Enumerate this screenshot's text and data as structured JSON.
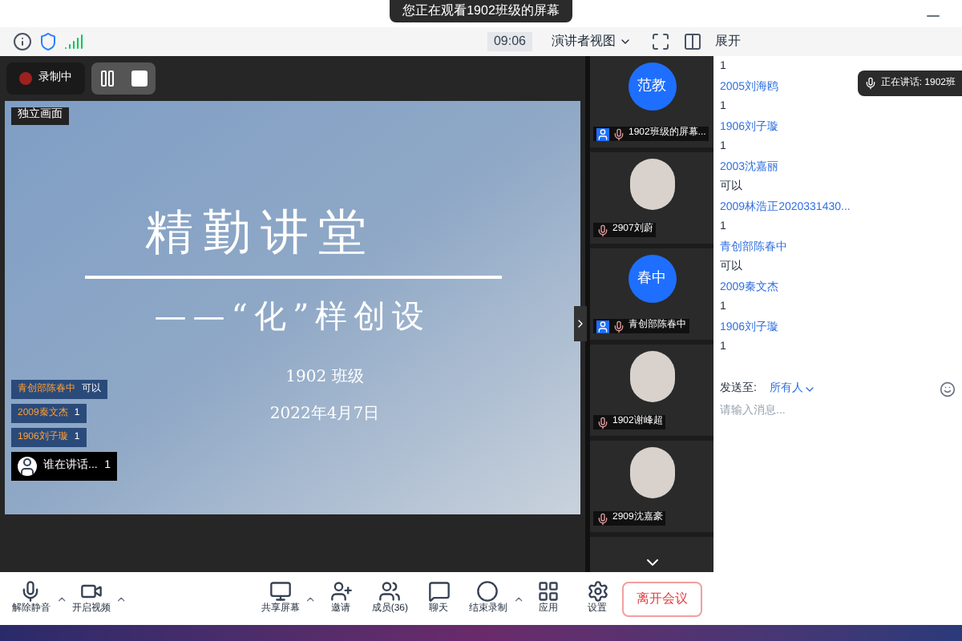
{
  "toast": "您正在观看1902班级的屏幕",
  "top_bar": {
    "time": "09:06",
    "view": "演讲者视图",
    "panel": "展开"
  },
  "recording": {
    "label": "录制中",
    "paused": false
  },
  "screen_label": "独立画面",
  "slide": {
    "title": "精勤讲堂",
    "subtitle": "——“化”样创设",
    "author": "1902 班级",
    "date": "2022年4月7日"
  },
  "danmaku": [
    {
      "name": "青创部陈春中",
      "text": "可以"
    },
    {
      "name": "2009秦文杰",
      "text": "1"
    },
    {
      "name": "1906刘子璇",
      "text": "1"
    }
  ],
  "speaking_bubble": {
    "text": "谁在讲话...",
    "count": "1"
  },
  "tiles": [
    {
      "name": "1902班级的屏幕...",
      "kind": "initials",
      "initials": "范教",
      "color": "#1e6fff",
      "host": true
    },
    {
      "name": "2907刘蔚",
      "kind": "picture",
      "host": false
    },
    {
      "name": "青创部陈春中",
      "kind": "initials",
      "initials": "春中",
      "color": "#1e6fff",
      "host": true
    },
    {
      "name": "1902谢峰超",
      "kind": "picture",
      "host": false
    },
    {
      "name": "2909沈嘉豪",
      "kind": "picture",
      "host": false
    }
  ],
  "chat": [
    {
      "kind": "message",
      "text": "1"
    },
    {
      "kind": "sender",
      "text": "2005刘海鸥"
    },
    {
      "kind": "message",
      "text": "1"
    },
    {
      "kind": "sender",
      "text": "1906刘子璇"
    },
    {
      "kind": "message",
      "text": "1"
    },
    {
      "kind": "sender",
      "text": "2003沈嘉丽"
    },
    {
      "kind": "message",
      "text": "可以"
    },
    {
      "kind": "sender",
      "text": "2009林浩正2020331430..."
    },
    {
      "kind": "message",
      "text": "1"
    },
    {
      "kind": "sender",
      "text": "青创部陈春中"
    },
    {
      "kind": "message",
      "text": "可以"
    },
    {
      "kind": "sender",
      "text": "2009秦文杰"
    },
    {
      "kind": "message",
      "text": "1"
    },
    {
      "kind": "sender",
      "text": "1906刘子璇"
    },
    {
      "kind": "message",
      "text": "1"
    }
  ],
  "speaking_toast": "正在讲话: 1902班",
  "send_to": {
    "label": "发送至:",
    "target": "所有人"
  },
  "chat_input": {
    "placeholder": "请输入消息..."
  },
  "toolbar": [
    {
      "kind": "mic",
      "label": "解除静音"
    },
    {
      "kind": "video",
      "label": "开启视频"
    },
    {
      "kind": "share",
      "label": "共享屏幕"
    },
    {
      "kind": "invite",
      "label": "邀请"
    },
    {
      "kind": "members",
      "label": "成员(36)"
    },
    {
      "kind": "chat",
      "label": "聊天"
    },
    {
      "kind": "record",
      "label": "结束录制"
    },
    {
      "kind": "apps",
      "label": "应用"
    },
    {
      "kind": "settings",
      "label": "设置"
    }
  ],
  "leave_button": "离开会议"
}
